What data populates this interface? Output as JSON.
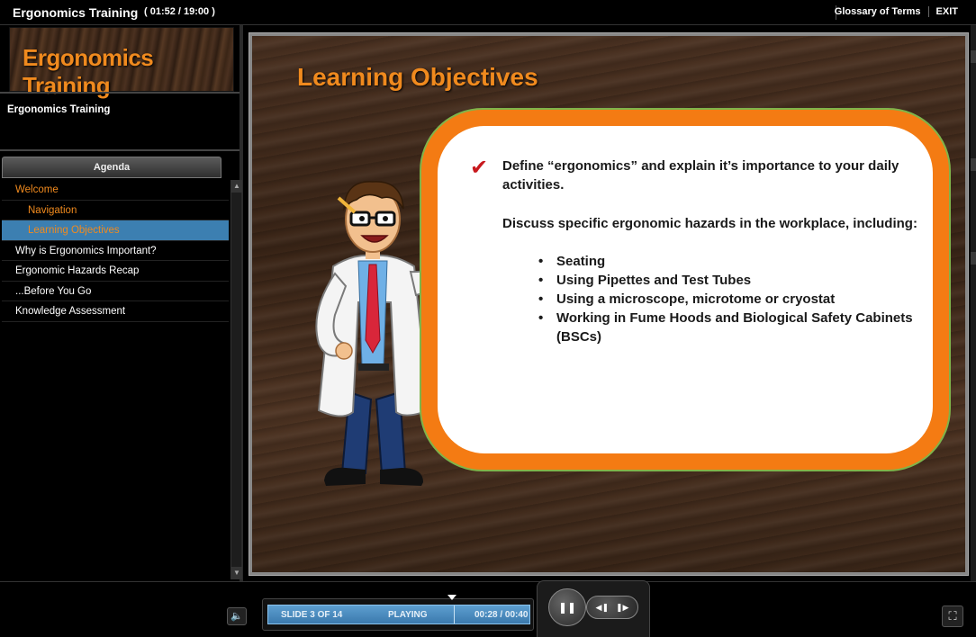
{
  "topbar": {
    "title": "Ergonomics Training",
    "time": "( 01:52 / 19:00 )",
    "glossary_label": "Glossary of Terms",
    "exit_label": "EXIT"
  },
  "sidebar": {
    "logo_text": "Ergonomics Training",
    "course_title": "Ergonomics Training",
    "agenda_tab": "Agenda",
    "items": [
      {
        "label": "Welcome"
      },
      {
        "label": "Navigation"
      },
      {
        "label": "Learning Objectives"
      },
      {
        "label": "Why is Ergonomics Important?"
      },
      {
        "label": "Ergonomic Hazards Recap"
      },
      {
        "label": "...Before You Go"
      },
      {
        "label": "Knowledge Assessment"
      }
    ]
  },
  "slide": {
    "title": "Learning Objectives",
    "objective_1": "Define “ergonomics” and explain it’s importance to your daily activities.",
    "objective_2": "Discuss specific ergonomic hazards in the workplace, including:",
    "bullets": [
      "Seating",
      "Using Pipettes and Test Tubes",
      "Using a microscope, microtome or cryostat",
      "Working in Fume Hoods and Biological Safety Cabinets (BSCs)"
    ],
    "check_icon": "check-icon",
    "accent_color": "#f08a1e"
  },
  "player": {
    "slide_count": "SLIDE 3 OF 14",
    "state": "PLAYING",
    "time": "00:28 / 00:40",
    "volume_icon": "speaker-icon",
    "pause_icon": "pause-icon",
    "rewind_icon": "rewind-icon",
    "forward_icon": "forward-icon",
    "fullscreen_icon": "fullscreen-icon"
  }
}
